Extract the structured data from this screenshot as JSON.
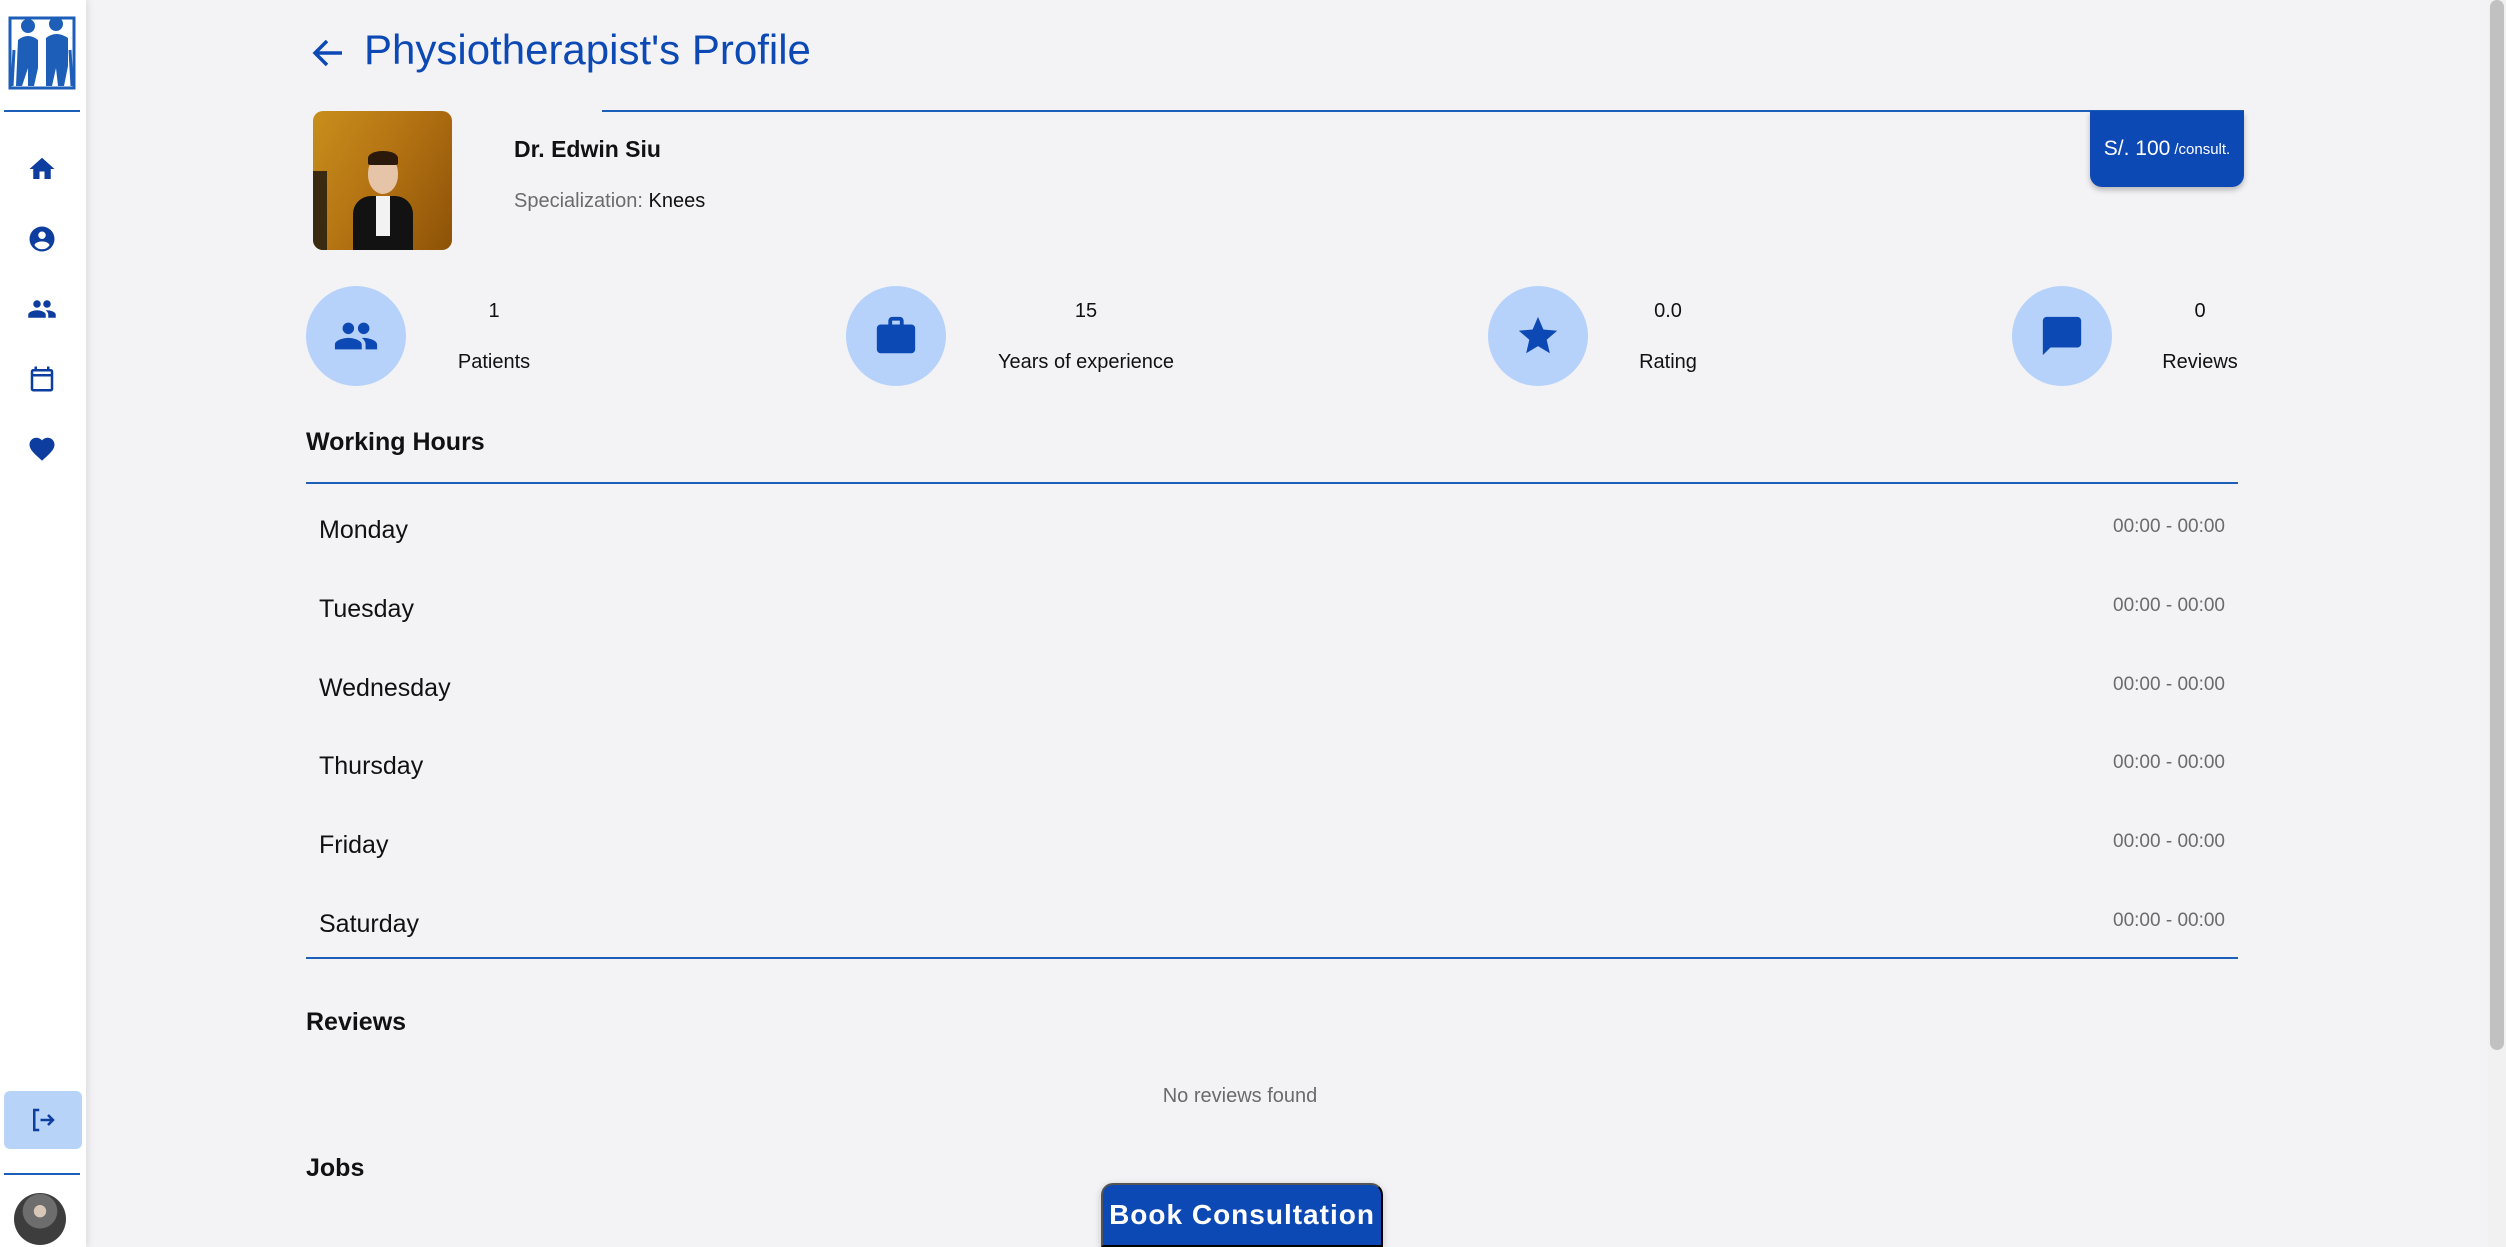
{
  "sidebar": {
    "logo_icon": "elderly-couple-logo-icon",
    "nav": [
      {
        "icon": "home-icon"
      },
      {
        "icon": "account-icon"
      },
      {
        "icon": "people-icon"
      },
      {
        "icon": "calendar-icon"
      },
      {
        "icon": "heart-icon"
      }
    ],
    "logout_icon": "logout-icon"
  },
  "header": {
    "back_icon": "arrow-left-icon",
    "title": "Physiotherapist's Profile"
  },
  "profile": {
    "name": "Dr. Edwin Siu",
    "specialization_label": "Specialization:",
    "specialization_value": "Knees",
    "price_amount": "S/. 100",
    "price_unit": "/consult."
  },
  "stats": [
    {
      "icon": "people-icon",
      "value": "1",
      "label": "Patients"
    },
    {
      "icon": "briefcase-icon",
      "value": "15",
      "label": "Years of experience"
    },
    {
      "icon": "star-icon",
      "value": "0.0",
      "label": "Rating"
    },
    {
      "icon": "chat-icon",
      "value": "0",
      "label": "Reviews"
    }
  ],
  "working_hours": {
    "title": "Working Hours",
    "days": [
      {
        "day": "Monday",
        "hours": "00:00 - 00:00"
      },
      {
        "day": "Tuesday",
        "hours": "00:00 - 00:00"
      },
      {
        "day": "Wednesday",
        "hours": "00:00 - 00:00"
      },
      {
        "day": "Thursday",
        "hours": "00:00 - 00:00"
      },
      {
        "day": "Friday",
        "hours": "00:00 - 00:00"
      },
      {
        "day": "Saturday",
        "hours": "00:00 - 00:00"
      }
    ]
  },
  "reviews": {
    "title": "Reviews",
    "empty_text": "No reviews found"
  },
  "jobs": {
    "title": "Jobs"
  },
  "actions": {
    "book_label": "Book Consultation"
  },
  "colors": {
    "primary": "#0d49b5",
    "accent_light": "#b6d2fb",
    "background": "#f3f3f6"
  }
}
